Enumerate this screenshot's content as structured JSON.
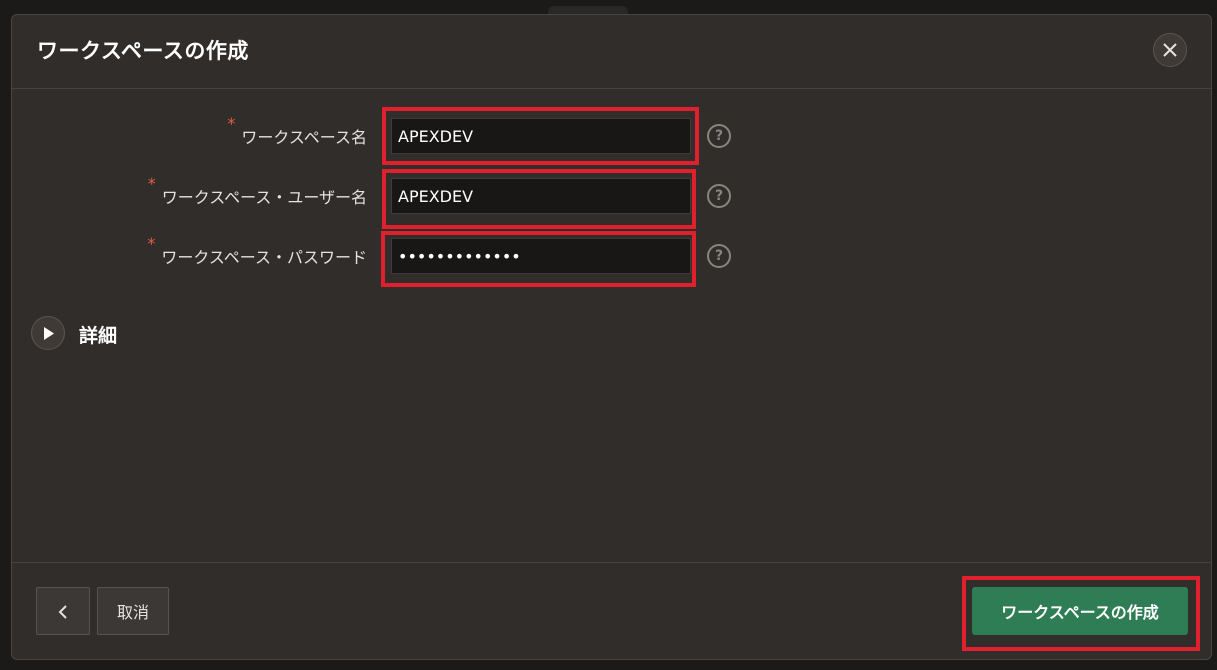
{
  "dialog": {
    "title": "ワークスペースの作成",
    "close_icon": "close-icon"
  },
  "form": {
    "required_marker": "*",
    "fields": [
      {
        "label": "ワークスペース名",
        "value": "APEXDEV",
        "type": "text",
        "help_icon": "?"
      },
      {
        "label": "ワークスペース・ユーザー名",
        "value": "APEXDEV",
        "type": "text",
        "help_icon": "?"
      },
      {
        "label": "ワークスペース・パスワード",
        "value": "•••••••••••••",
        "type": "password",
        "help_icon": "?"
      }
    ]
  },
  "details": {
    "label": "詳細",
    "toggle_icon": "play-icon"
  },
  "footer": {
    "back_icon": "chevron-left-icon",
    "cancel_label": "取消",
    "create_label": "ワークスペースの作成"
  },
  "colors": {
    "accent_primary": "#2e7d55",
    "highlight": "#e0202c",
    "required": "#e25c4b",
    "dialog_bg": "#312d2a"
  }
}
